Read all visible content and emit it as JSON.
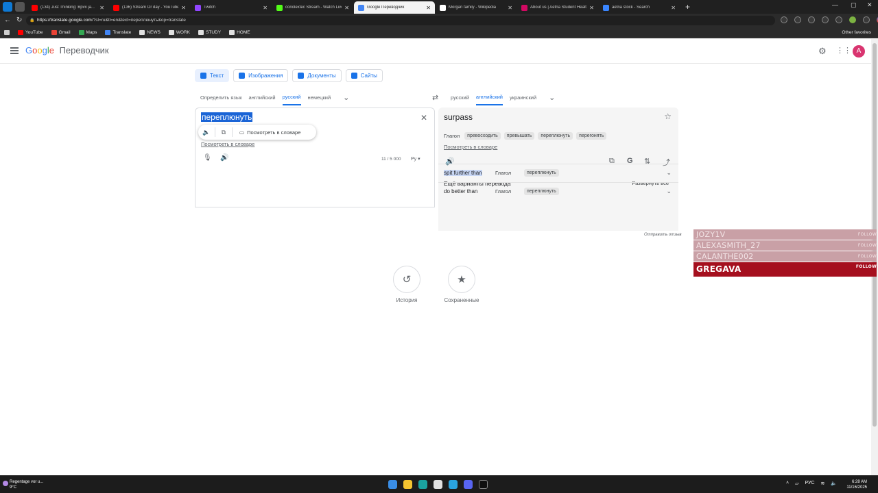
{
  "browser": {
    "tabs": [
      {
        "label": "(134) Just Thinking: Bpvx ja...",
        "color": "#ff0000"
      },
      {
        "label": "(136) Stream Or day - YouTube",
        "color": "#ff0000"
      },
      {
        "label": "Twitch",
        "color": "#9146ff"
      },
      {
        "label": "conolextec Stream - Watch Live o...",
        "color": "#53fc18"
      },
      {
        "label": "Google Переводчик",
        "color": "#4285f4"
      },
      {
        "label": "Morgan family - Wikipedia",
        "color": "#ffffff"
      },
      {
        "label": "About us | Aetna Student Health",
        "color": "#d20962"
      },
      {
        "label": "aetna stock - Search",
        "color": "#3a86ff"
      }
    ],
    "active_tab": 4,
    "url_host": "https://translate.google.com",
    "url_rest": "/?sl=ru&tl=en&text=переплюнуть&op=translate",
    "bookmarks": [
      {
        "label": "YouTube",
        "color": "#ff0000"
      },
      {
        "label": "Gmail",
        "color": "#ea4335"
      },
      {
        "label": "Maps",
        "color": "#34a853"
      },
      {
        "label": "Translate",
        "color": "#4285f4"
      },
      {
        "label": "NEWS",
        "color": "#e0e0e0"
      },
      {
        "label": "WORK",
        "color": "#e0e0e0"
      },
      {
        "label": "STUDY",
        "color": "#e0e0e0"
      },
      {
        "label": "HOME",
        "color": "#e0e0e0"
      }
    ],
    "other_favorites": "Other favorites"
  },
  "header": {
    "logo": {
      "g1": "G",
      "g2": "o",
      "g3": "o",
      "g4": "g",
      "g5": "l",
      "g6": "e"
    },
    "product": "Переводчик",
    "avatar_letter": "A"
  },
  "modes": [
    {
      "label": "Текст",
      "icon": "translate-icon"
    },
    {
      "label": "Изображения",
      "icon": "image-icon"
    },
    {
      "label": "Документы",
      "icon": "document-icon"
    },
    {
      "label": "Сайты",
      "icon": "website-icon"
    }
  ],
  "source_langs": [
    "Определить язык",
    "английский",
    "русский",
    "немецкий"
  ],
  "source_active": 2,
  "target_langs": [
    "русский",
    "английский",
    "украинский"
  ],
  "target_active": 1,
  "source": {
    "text": "переплюнуть",
    "popup_dict": "Посмотреть в словаре",
    "dict_link": "Посмотреть в словаре",
    "char_count": "11 / 5 000",
    "lang_selector": "Ру"
  },
  "target": {
    "text": "surpass",
    "pos": "Глагол",
    "chips": [
      "превосходить",
      "превышать",
      "переплюнуть",
      "перегонять"
    ],
    "dict_link": "Посмотреть в словаре",
    "more_title": "Ещё варианты перевода",
    "expand_all": "Развернуть все",
    "alternatives": [
      {
        "word": "spit further than",
        "pos": "Глагол",
        "chip": "переплюнуть"
      },
      {
        "word": "do better than",
        "pos": "Глагол",
        "chip": "переплюнуть"
      }
    ],
    "feedback": "Отправить отзыв"
  },
  "history": {
    "label": "История"
  },
  "saved": {
    "label": "Сохраненные"
  },
  "overlay": {
    "rows": [
      "JOZY1V",
      "ALEXASMITH_27",
      "CALANTHE002"
    ],
    "follow": "FOLLOW",
    "main": "GREGAVA"
  },
  "taskbar": {
    "weather_title": "Regentage vor u...",
    "weather_temp": "9°C",
    "lang": "РУС",
    "time": "6:28 AM",
    "date": "11/16/2025"
  }
}
